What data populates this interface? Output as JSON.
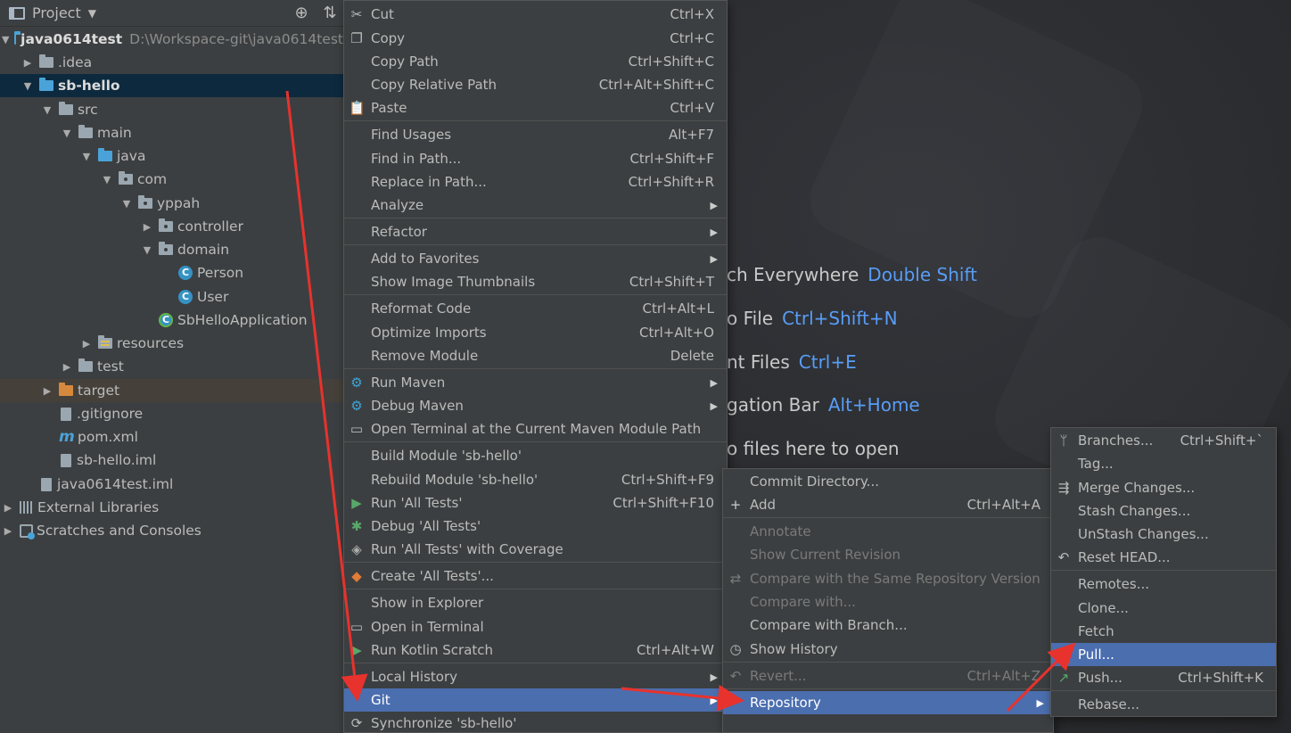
{
  "project_panel": {
    "title": "Project",
    "tree": [
      {
        "label": "java0614test",
        "path": "D:\\Workspace-git\\java0614test",
        "expanded": true
      },
      {
        "label": ".idea"
      },
      {
        "label": "sb-hello",
        "expanded": true
      },
      {
        "label": "src"
      },
      {
        "label": "main"
      },
      {
        "label": "java"
      },
      {
        "label": "com"
      },
      {
        "label": "yppah"
      },
      {
        "label": "controller"
      },
      {
        "label": "domain"
      },
      {
        "label": "Person"
      },
      {
        "label": "User"
      },
      {
        "label": "SbHelloApplication"
      },
      {
        "label": "resources"
      },
      {
        "label": "test"
      },
      {
        "label": "target"
      },
      {
        "label": ".gitignore"
      },
      {
        "label": "pom.xml"
      },
      {
        "label": "sb-hello.iml"
      },
      {
        "label": "java0614test.iml"
      },
      {
        "label": "External Libraries"
      },
      {
        "label": "Scratches and Consoles"
      }
    ]
  },
  "editor_hints": [
    {
      "text": "ch Everywhere",
      "key": "Double Shift"
    },
    {
      "text": "o File",
      "key": "Ctrl+Shift+N"
    },
    {
      "text": "nt Files",
      "key": "Ctrl+E"
    },
    {
      "text": "gation Bar",
      "key": "Alt+Home"
    },
    {
      "text": "o files here to open",
      "key": ""
    }
  ],
  "context_menu": [
    {
      "label": "Cut",
      "shortcut": "Ctrl+X",
      "icon": "scissors-icon"
    },
    {
      "label": "Copy",
      "shortcut": "Ctrl+C",
      "icon": "copy-icon"
    },
    {
      "label": "Copy Path",
      "shortcut": "Ctrl+Shift+C"
    },
    {
      "label": "Copy Relative Path",
      "shortcut": "Ctrl+Alt+Shift+C"
    },
    {
      "label": "Paste",
      "shortcut": "Ctrl+V",
      "icon": "clipboard-icon"
    },
    {
      "label": "Find Usages",
      "shortcut": "Alt+F7"
    },
    {
      "label": "Find in Path...",
      "shortcut": "Ctrl+Shift+F"
    },
    {
      "label": "Replace in Path...",
      "shortcut": "Ctrl+Shift+R"
    },
    {
      "label": "Analyze",
      "shortcut": ""
    },
    {
      "label": "Refactor",
      "shortcut": ""
    },
    {
      "label": "Add to Favorites",
      "shortcut": ""
    },
    {
      "label": "Show Image Thumbnails",
      "shortcut": "Ctrl+Shift+T"
    },
    {
      "label": "Reformat Code",
      "shortcut": "Ctrl+Alt+L"
    },
    {
      "label": "Optimize Imports",
      "shortcut": "Ctrl+Alt+O"
    },
    {
      "label": "Remove Module",
      "shortcut": "Delete"
    },
    {
      "label": "Run Maven",
      "shortcut": "",
      "icon": "gear-icon"
    },
    {
      "label": "Debug Maven",
      "shortcut": "",
      "icon": "gear-icon"
    },
    {
      "label": "Open Terminal at the Current Maven Module Path",
      "shortcut": "",
      "icon": "terminal-icon"
    },
    {
      "label": "Build Module 'sb-hello'",
      "shortcut": ""
    },
    {
      "label": "Rebuild Module 'sb-hello'",
      "shortcut": "Ctrl+Shift+F9"
    },
    {
      "label": "Run 'All Tests'",
      "shortcut": "Ctrl+Shift+F10",
      "icon": "play-icon"
    },
    {
      "label": "Debug 'All Tests'",
      "shortcut": "",
      "icon": "bug-icon"
    },
    {
      "label": "Run 'All Tests' with Coverage",
      "shortcut": "",
      "icon": "shield-icon"
    },
    {
      "label": "Create 'All Tests'...",
      "shortcut": "",
      "icon": "diamond-icon"
    },
    {
      "label": "Show in Explorer",
      "shortcut": ""
    },
    {
      "label": "Open in Terminal",
      "shortcut": "",
      "icon": "terminal-icon"
    },
    {
      "label": "Run Kotlin Scratch",
      "shortcut": "Ctrl+Alt+W",
      "icon": "play-icon"
    },
    {
      "label": "Local History",
      "shortcut": ""
    },
    {
      "label": "Git",
      "shortcut": ""
    },
    {
      "label": "Synchronize 'sb-hello'",
      "shortcut": "",
      "icon": "sync-icon"
    }
  ],
  "git_menu": [
    {
      "label": "Commit Directory...",
      "shortcut": ""
    },
    {
      "label": "Add",
      "shortcut": "Ctrl+Alt+A",
      "icon": "plus-icon"
    },
    {
      "label": "Annotate",
      "shortcut": ""
    },
    {
      "label": "Show Current Revision",
      "shortcut": ""
    },
    {
      "label": "Compare with the Same Repository Version",
      "shortcut": "",
      "icon": "compare-icon"
    },
    {
      "label": "Compare with...",
      "shortcut": ""
    },
    {
      "label": "Compare with Branch...",
      "shortcut": ""
    },
    {
      "label": "Show History",
      "shortcut": "",
      "icon": "clock-icon"
    },
    {
      "label": "Revert...",
      "shortcut": "Ctrl+Alt+Z",
      "icon": "revert-icon"
    },
    {
      "label": "Repository",
      "shortcut": ""
    }
  ],
  "repository_menu": [
    {
      "label": "Branches...",
      "shortcut": "Ctrl+Shift+`",
      "icon": "branch-icon"
    },
    {
      "label": "Tag...",
      "shortcut": ""
    },
    {
      "label": "Merge Changes...",
      "shortcut": "",
      "icon": "merge-icon"
    },
    {
      "label": "Stash Changes...",
      "shortcut": ""
    },
    {
      "label": "UnStash Changes...",
      "shortcut": ""
    },
    {
      "label": "Reset HEAD...",
      "shortcut": "",
      "icon": "undo-icon"
    },
    {
      "label": "Remotes...",
      "shortcut": ""
    },
    {
      "label": "Clone...",
      "shortcut": ""
    },
    {
      "label": "Fetch",
      "shortcut": ""
    },
    {
      "label": "Pull...",
      "shortcut": "",
      "icon": "pull-icon"
    },
    {
      "label": "Push...",
      "shortcut": "Ctrl+Shift+K",
      "icon": "push-icon"
    },
    {
      "label": "Rebase...",
      "shortcut": ""
    }
  ],
  "colors": {
    "highlight": "#4b6eaf",
    "annotation_arrow": "#e8322d",
    "link_key": "#589df6"
  }
}
